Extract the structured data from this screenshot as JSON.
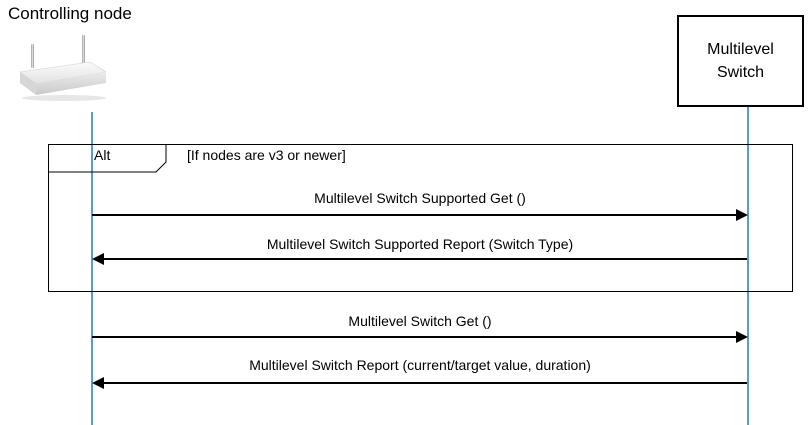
{
  "participants": {
    "controller": {
      "label": "Controlling node",
      "icon": "router-icon"
    },
    "switch": {
      "label_line1": "Multilevel",
      "label_line2": "Switch"
    }
  },
  "alt_fragment": {
    "operator": "Alt",
    "guard": "[If nodes are v3 or newer]"
  },
  "messages": [
    {
      "label": "Multilevel Switch Supported Get ()",
      "from": "controller",
      "to": "switch"
    },
    {
      "label": "Multilevel Switch Supported Report (Switch Type)",
      "from": "switch",
      "to": "controller"
    },
    {
      "label": "Multilevel Switch Get ()",
      "from": "controller",
      "to": "switch"
    },
    {
      "label": "Multilevel Switch Report (current/target value, duration)",
      "from": "switch",
      "to": "controller"
    }
  ],
  "colors": {
    "lifeline": "#5b9bd5",
    "arrow": "#000000"
  }
}
